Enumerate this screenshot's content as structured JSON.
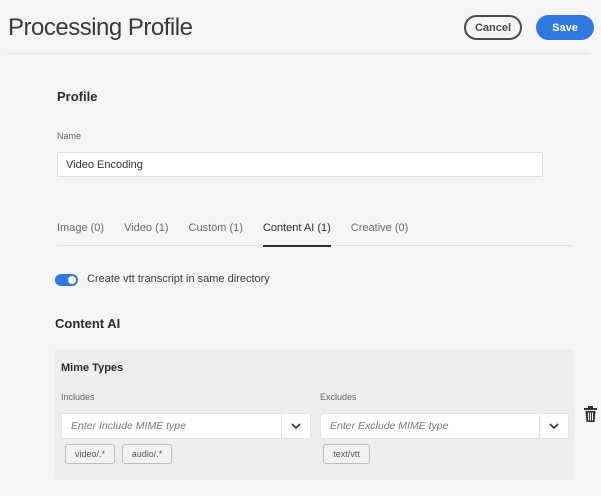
{
  "header": {
    "title": "Processing Profile",
    "cancel_label": "Cancel",
    "save_label": "Save"
  },
  "profile": {
    "heading": "Profile",
    "name_label": "Name",
    "name_value": "Video Encoding"
  },
  "tabs": [
    {
      "label": "Image (0)"
    },
    {
      "label": "Video (1)"
    },
    {
      "label": "Custom (1)"
    },
    {
      "label": "Content AI (1)",
      "active": true
    },
    {
      "label": "Creative (0)"
    }
  ],
  "toggle": {
    "label": "Create vtt transcript in same directory",
    "on": true
  },
  "content_ai": {
    "heading": "Content AI",
    "mime_heading": "Mime Types",
    "includes": {
      "label": "Includes",
      "placeholder": "Enter Include MIME type",
      "chips": [
        "video/.*",
        "audio/.*"
      ]
    },
    "excludes": {
      "label": "Excludes",
      "placeholder": "Enter Exclude MIME type",
      "chips": [
        "text/vtt"
      ]
    }
  },
  "colors": {
    "accent": "#2f79e0"
  }
}
